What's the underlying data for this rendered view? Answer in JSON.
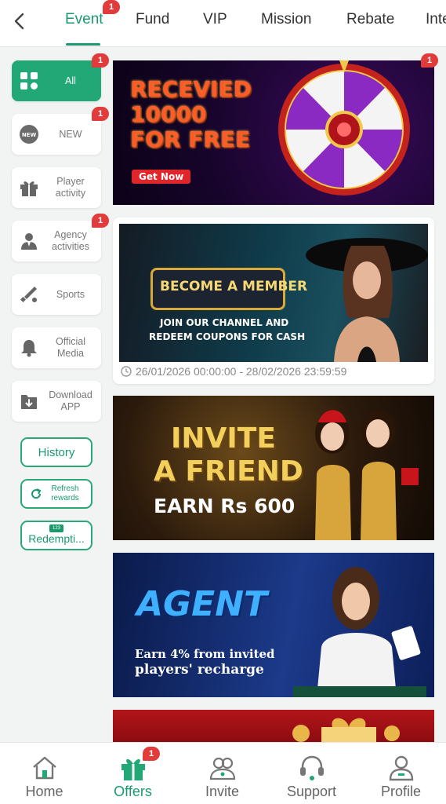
{
  "tabs": [
    {
      "label": "Event",
      "badge": "1",
      "active": true
    },
    {
      "label": "Fund"
    },
    {
      "label": "VIP"
    },
    {
      "label": "Mission"
    },
    {
      "label": "Rebate"
    },
    {
      "label": "Inte"
    }
  ],
  "sidebar": {
    "items": [
      {
        "label": "All",
        "icon": "grid-icon",
        "badge": "1",
        "active": true
      },
      {
        "label": "NEW",
        "icon": "new-badge-icon",
        "badge": "1"
      },
      {
        "label": "Player activity",
        "icon": "gift-icon"
      },
      {
        "label": "Agency activities",
        "icon": "agent-icon",
        "badge": "1"
      },
      {
        "label": "Sports",
        "icon": "sports-icon"
      },
      {
        "label": "Official Media",
        "icon": "bell-icon"
      },
      {
        "label": "Download APP",
        "icon": "download-icon"
      }
    ],
    "history_label": "History",
    "refresh_label": "Refresh rewards",
    "redemption_label": "Redempti...",
    "redemption_icon_text": "123"
  },
  "banners": {
    "wheel": {
      "line1": "RECEVIED",
      "line2": "10000",
      "line3": "FOR FREE",
      "cta": "Get Now",
      "badge": "1"
    },
    "member": {
      "title": "BECOME A MEMBER",
      "sub1": "JOIN OUR CHANNEL AND",
      "sub2": "REDEEM COUPONS FOR CASH",
      "date": "26/01/2026 00:00:00 - 28/02/2026 23:59:59"
    },
    "invite": {
      "line1": "INVITE",
      "line2": "A FRIEND",
      "line3": "EARN Rs 600"
    },
    "agent": {
      "title": "AGENT",
      "sub1": "Earn 4% from invited",
      "sub2": "players' recharge"
    }
  },
  "bottom_nav": [
    {
      "label": "Home",
      "icon": "home-icon"
    },
    {
      "label": "Offers",
      "icon": "gift-icon",
      "badge": "1",
      "active": true
    },
    {
      "label": "Invite",
      "icon": "invite-icon"
    },
    {
      "label": "Support",
      "icon": "headset-icon"
    },
    {
      "label": "Profile",
      "icon": "profile-icon"
    }
  ],
  "colors": {
    "accent": "#1a9a6c",
    "badge": "#e23b3b"
  }
}
